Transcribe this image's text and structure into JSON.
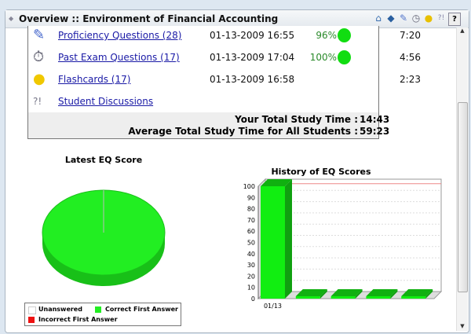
{
  "header": {
    "title": "Overview :: Environment of Financial Accounting",
    "icons": [
      "home-icon",
      "book-icon",
      "pencil-icon",
      "stopwatch-icon",
      "lightbulb-icon",
      "discussion-icon"
    ],
    "help_label": "?"
  },
  "rows": [
    {
      "icon": "pencil-icon",
      "glyph": "✎",
      "label": "Proficiency Questions (28)",
      "date": "01-13-2009 16:55",
      "pct": "96%",
      "time": "7:20",
      "pie": true
    },
    {
      "icon": "stopwatch-icon",
      "glyph": "⏱",
      "label": "Past Exam Questions (17)",
      "date": "01-13-2009 17:04",
      "pct": "100%",
      "time": "4:56",
      "pie": true
    },
    {
      "icon": "lightbulb-icon",
      "glyph": "💡",
      "label": "Flashcards (17)",
      "date": "01-13-2009 16:58",
      "pct": "",
      "time": "2:23",
      "pie": false
    },
    {
      "icon": "discussion-icon",
      "glyph": "?!",
      "label": "Student Discussions",
      "date": "",
      "pct": "",
      "time": "",
      "pie": false
    }
  ],
  "summary": {
    "your_label": "Your Total Study Time :",
    "your_value": "14:43",
    "avg_label": "Average Total Study Time for All Students :",
    "avg_value": "59:23"
  },
  "chart_data": [
    {
      "type": "pie",
      "title": "Latest EQ Score",
      "slices": [
        {
          "name": "Correct First Answer",
          "value": 100,
          "color": "#22ee22"
        },
        {
          "name": "Incorrect First Answer",
          "value": 0,
          "color": "#ee1111"
        },
        {
          "name": "Unanswered",
          "value": 0,
          "color": "#ffffff"
        }
      ],
      "legend": [
        "Unanswered",
        "Correct First Answer",
        "Incorrect First Answer"
      ],
      "legend_placement": "bottom"
    },
    {
      "type": "bar",
      "title": "History of EQ Scores",
      "categories": [
        "01/13",
        "",
        "",
        "",
        ""
      ],
      "values": [
        100,
        0,
        0,
        0,
        0
      ],
      "reference_line": 96,
      "ylim": [
        0,
        100
      ],
      "yticks": [
        "0",
        "10",
        "20",
        "30",
        "40",
        "50",
        "60",
        "70",
        "80",
        "90",
        "100"
      ],
      "grid": true
    }
  ]
}
